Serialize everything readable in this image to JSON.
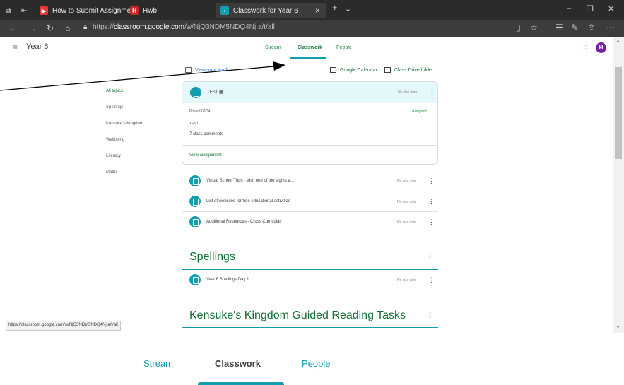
{
  "browser": {
    "tabs": [
      {
        "label": "How to Submit Assignment"
      },
      {
        "label": "Hwb"
      },
      {
        "label": "Classwork for Year 6"
      }
    ],
    "url_prefix": "https://",
    "url_host": "classroom.google.com",
    "url_path": "/w/NjQ3NDM5NDQ4NjIa/t/all",
    "status_url": "https://classroom.google.com/w/NjQ3NDM5NDQ4NjIa/t/all"
  },
  "header": {
    "class_name": "Year 6",
    "tabs": [
      {
        "label": "Stream"
      },
      {
        "label": "Classwork"
      },
      {
        "label": "People"
      }
    ],
    "avatar_letter": "H"
  },
  "toolbar": {
    "view_work": "View your work",
    "calendar": "Google Calendar",
    "drive": "Class Drive folder"
  },
  "topics": [
    "All topics",
    "Spellings",
    "Kensuke's Kingdom ...",
    "Wellbeing",
    "Literacy",
    "Maths"
  ],
  "expanded": {
    "title": "TEST",
    "due": "No due date",
    "posted": "Posted 09:34",
    "status": "Assigned",
    "body": "TEST",
    "comments": "7 class comments",
    "view_link": "View assignment"
  },
  "items": [
    {
      "title": "Virtual School Trips - Visit one of the sights a...",
      "due": "No due date"
    },
    {
      "title": "List of websites for free educational activities",
      "due": "No due date"
    },
    {
      "title": "Additional Resources - Cross Curricular",
      "due": "No due date"
    }
  ],
  "sections": [
    {
      "title": "Spellings",
      "items": [
        {
          "title": "Year 6 Spellings Day 1",
          "due": "No due date"
        }
      ]
    },
    {
      "title": "Kensuke's Kingdom Guided Reading Tasks"
    }
  ],
  "zoom": {
    "tabs": [
      {
        "label": "Stream"
      },
      {
        "label": "Classwork"
      },
      {
        "label": "People"
      }
    ]
  },
  "colors": {
    "accent": "#129eaf",
    "green_text": "#137333",
    "avatar": "#7b1fa2",
    "header_tint": "#e4f7fb"
  }
}
